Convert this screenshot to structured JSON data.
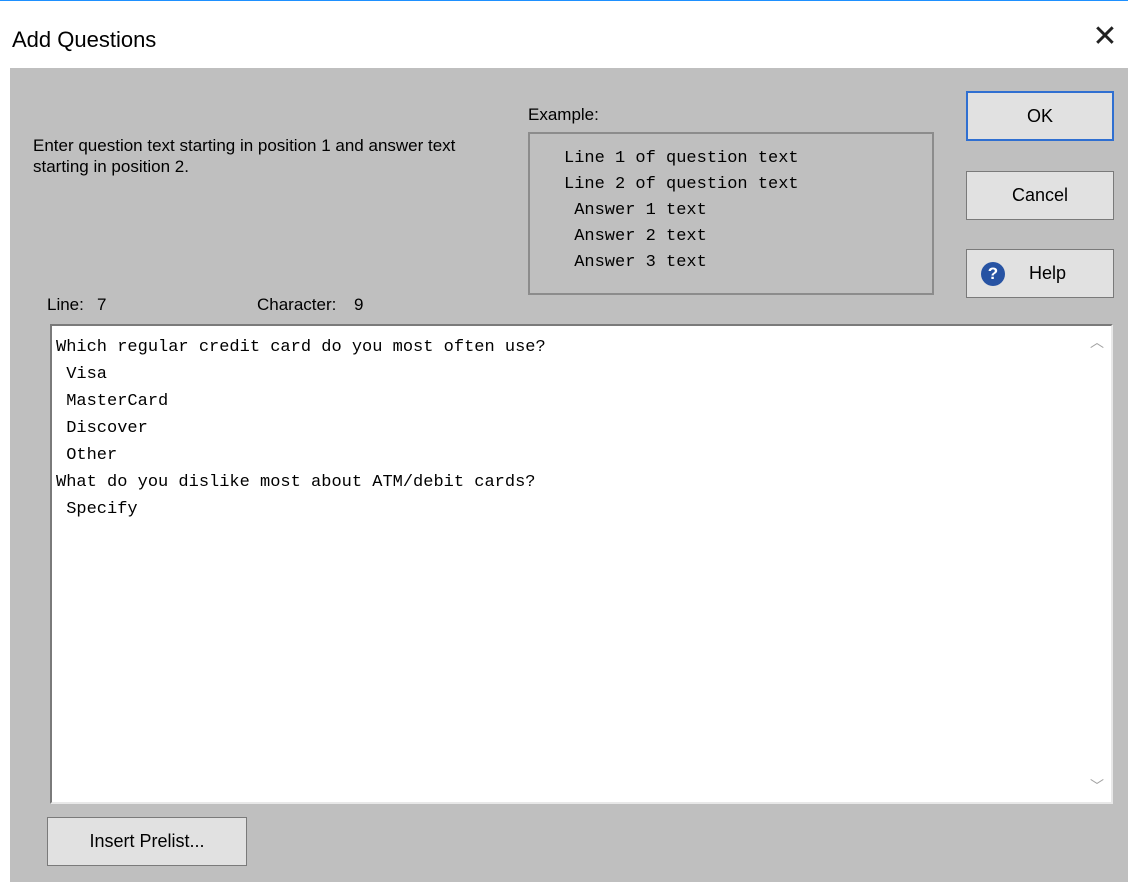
{
  "window": {
    "title": "Add Questions",
    "close_label": "✕"
  },
  "instructions": "Enter question text starting in position 1 and answer text starting in position 2.",
  "example": {
    "label": "Example:",
    "lines": [
      "Line 1 of question text",
      "Line 2 of question text",
      " Answer 1 text",
      " Answer 2 text",
      " Answer 3 text"
    ]
  },
  "buttons": {
    "ok": "OK",
    "cancel": "Cancel",
    "help": "Help",
    "insert_prelist": "Insert Prelist..."
  },
  "icons": {
    "help": "question-circle-icon",
    "scroll_up": "chevron-up-icon",
    "scroll_down": "chevron-down-icon"
  },
  "status": {
    "line_label": "Line:",
    "line_value": "7",
    "char_label": "Character:",
    "char_value": "9"
  },
  "editor": {
    "lines": [
      "Which regular credit card do you most often use?",
      " Visa",
      " MasterCard",
      " Discover",
      " Other",
      "What do you dislike most about ATM/debit cards?",
      " Specify"
    ]
  }
}
